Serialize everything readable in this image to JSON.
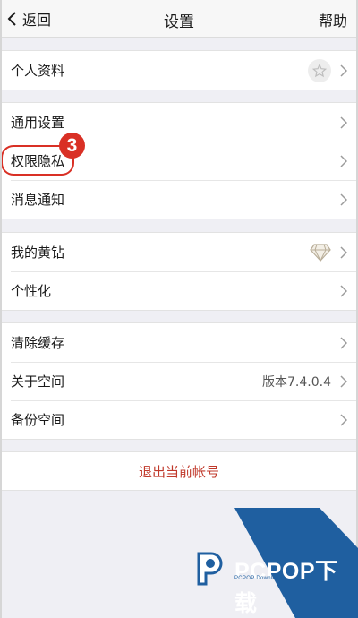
{
  "nav": {
    "back_label": "返回",
    "title": "设置",
    "help_label": "帮助"
  },
  "groups": [
    {
      "rows": [
        {
          "label": "个人资料",
          "icon": "star-icon"
        }
      ]
    },
    {
      "rows": [
        {
          "label": "通用设置"
        },
        {
          "label": "权限隐私",
          "highlighted": true
        },
        {
          "label": "消息通知"
        }
      ]
    },
    {
      "rows": [
        {
          "label": "我的黄钻",
          "icon": "diamond-icon"
        },
        {
          "label": "个性化"
        }
      ]
    },
    {
      "rows": [
        {
          "label": "清除缓存"
        },
        {
          "label": "关于空间",
          "value": "版本7.4.0.4"
        },
        {
          "label": "备份空间"
        }
      ]
    }
  ],
  "annotation": {
    "step_number": "3",
    "color": "#d93025"
  },
  "logout": {
    "label": "退出当前帐号",
    "color": "#c0392b"
  },
  "watermark": {
    "text_main": "PCPOP下载",
    "text_sub": "PCPOP Download",
    "brand_color": "#1f5fa0"
  },
  "colors": {
    "background": "#efeff4",
    "nav_background": "#f7f7f7"
  }
}
